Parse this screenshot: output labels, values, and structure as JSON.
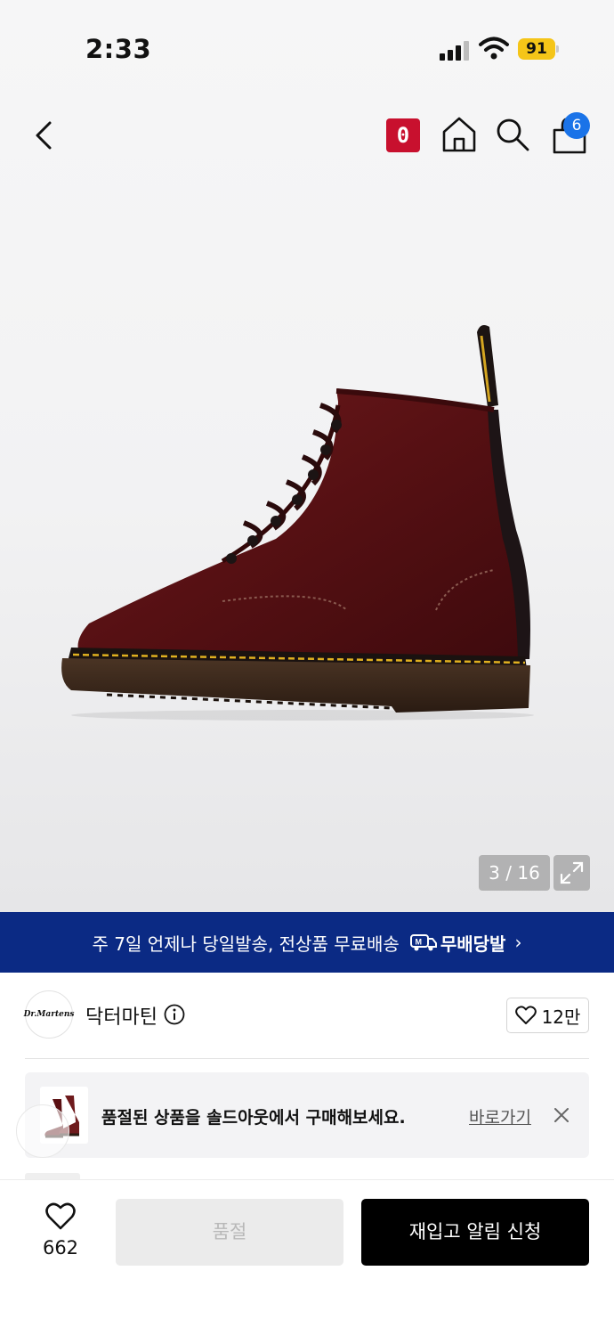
{
  "status_bar": {
    "time": "2:33",
    "battery": "91"
  },
  "header": {
    "notification_badge": "0",
    "cart_count": "6"
  },
  "gallery": {
    "counter": "3 / 16"
  },
  "shipping_banner": {
    "text": "주 7일 언제나 당일발송, 전상품 무료배송",
    "service_label": "무배당발",
    "logo_letter": "M"
  },
  "brand": {
    "name": "닥터마틴",
    "logo_text": "Dr.Martens",
    "like_count": "12만"
  },
  "soldout_notice": {
    "message": "품절된 상품을 솔드아웃에서 구매해보세요.",
    "link_label": "바로가기"
  },
  "bottom_bar": {
    "wish_count": "662",
    "soldout_label": "품절",
    "restock_label": "재입고 알림 신청"
  },
  "colors": {
    "banner_bg": "#0b2a84",
    "badge_red": "#c8102e",
    "cart_badge": "#1a73e8",
    "battery": "#f5c518",
    "boot": "#5a0f12"
  }
}
